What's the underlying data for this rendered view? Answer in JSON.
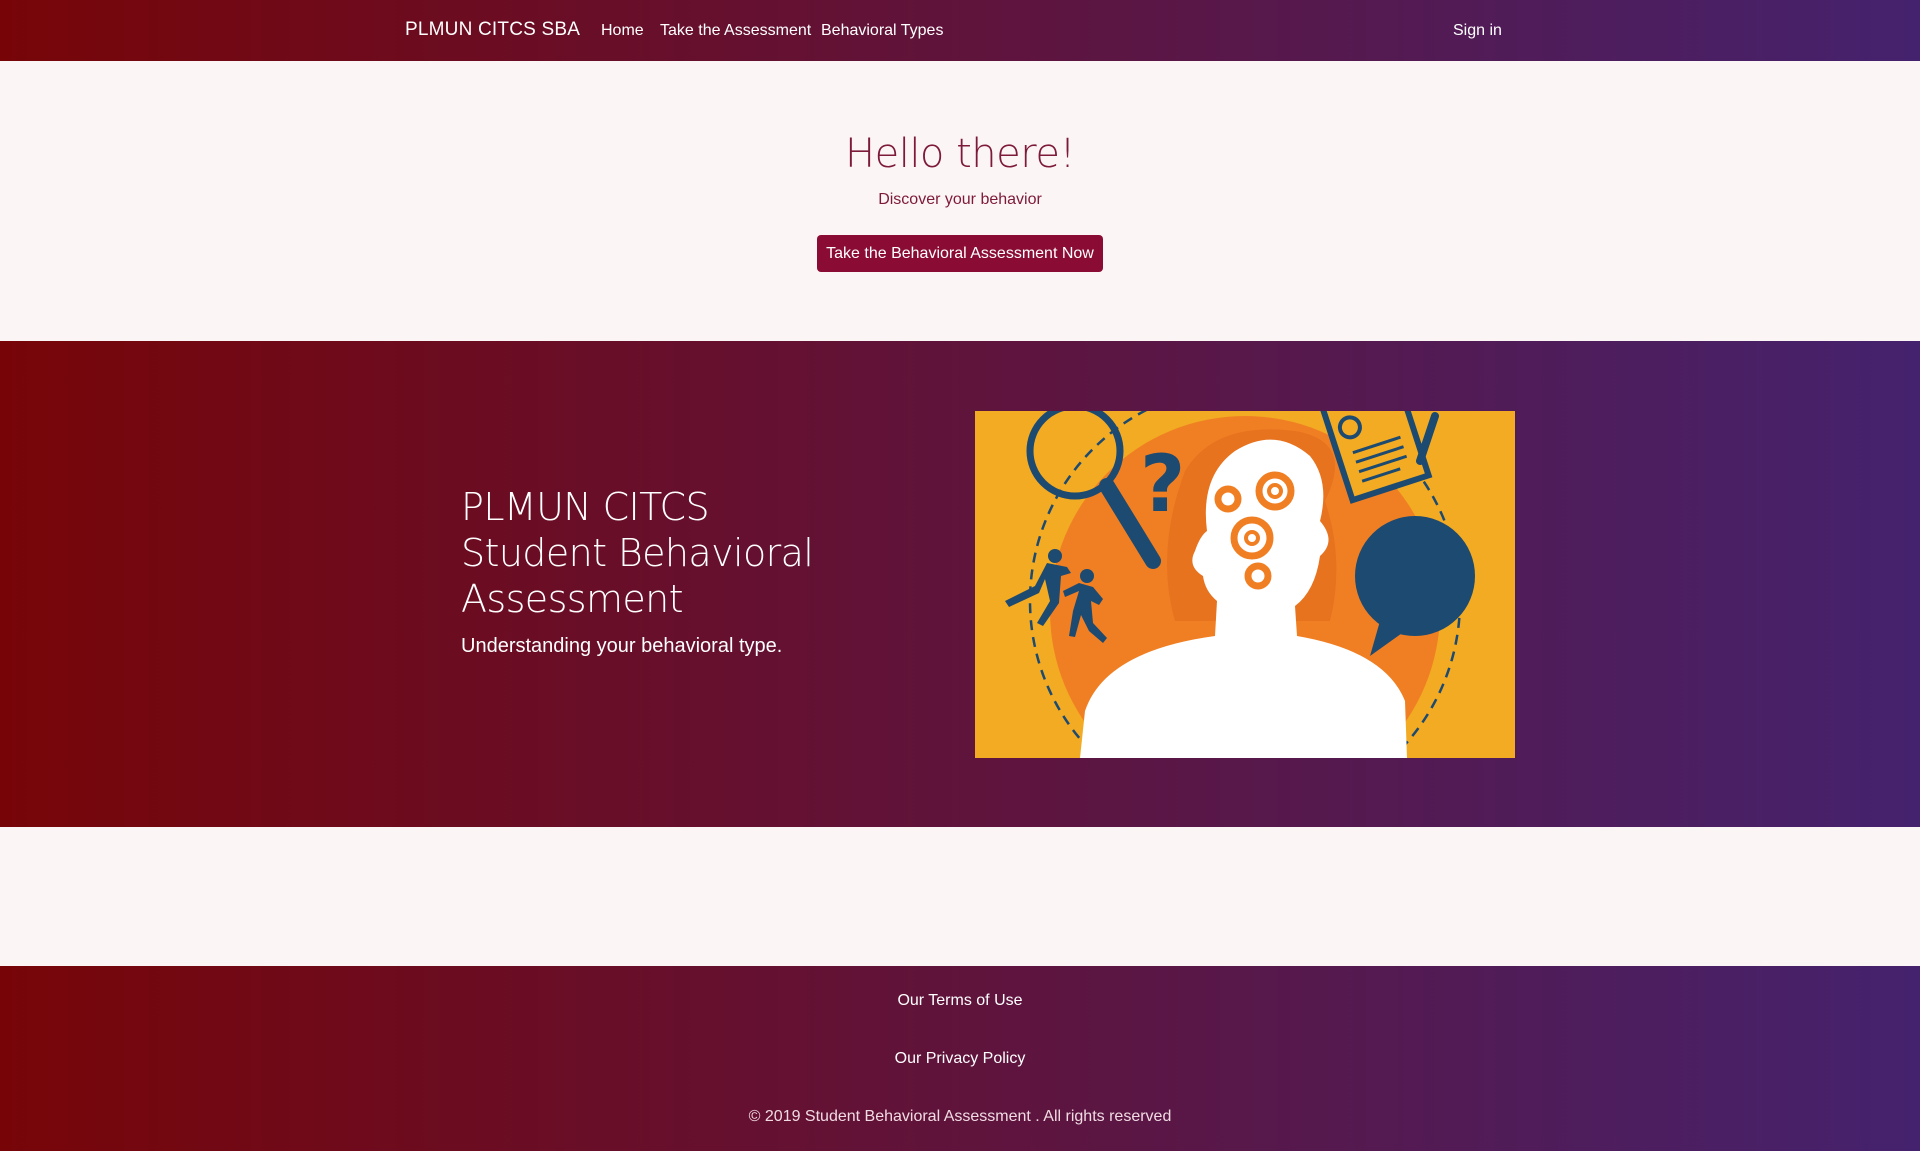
{
  "navbar": {
    "brand": "PLMUN CITCS SBA",
    "links": [
      "Home",
      "Take the Assessment",
      "Behavioral Types"
    ],
    "signin": "Sign in"
  },
  "hello": {
    "title": "Hello there!",
    "subtitle": "Discover your behavior",
    "button": "Take the Behavioral Assessment Now"
  },
  "hero": {
    "title_lines": [
      "PLMUN CITCS",
      "Student Behavioral",
      "Assessment"
    ],
    "subtitle": "Understanding your behavioral type."
  },
  "footer": {
    "terms": "Our Terms of Use",
    "privacy": "Our Privacy Policy",
    "copyright": "© 2019 Student Behavioral Assessment . All rights reserved"
  },
  "colors": {
    "gradient_start": "#770508",
    "gradient_mid": "#621236",
    "gradient_end": "#45226e",
    "accent": "#8a0c35",
    "page_background": "#fcf5f6"
  }
}
